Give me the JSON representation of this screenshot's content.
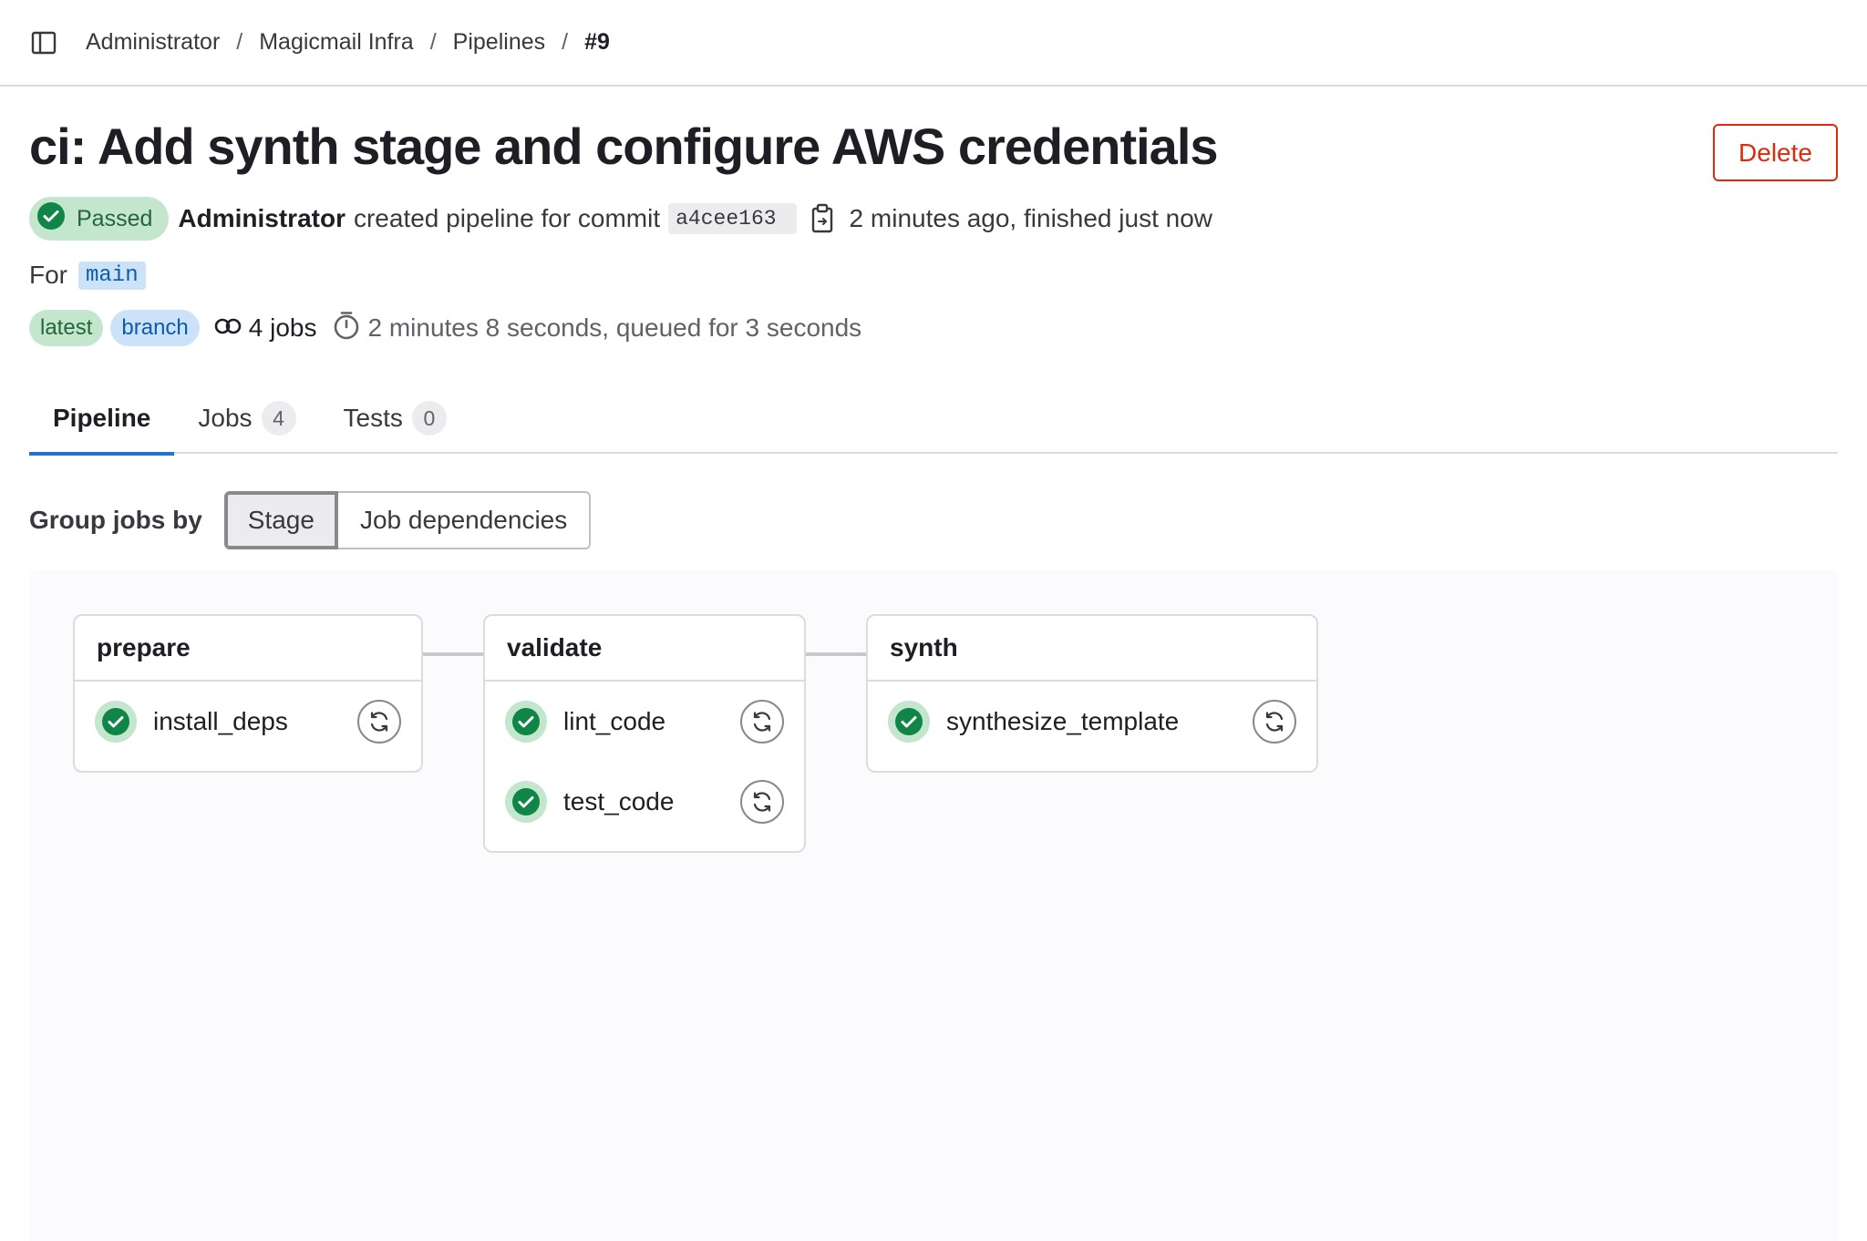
{
  "breadcrumb": {
    "items": [
      "Administrator",
      "Magicmail Infra",
      "Pipelines"
    ],
    "current": "#9",
    "separator": "/"
  },
  "header": {
    "title": "ci: Add synth stage and configure AWS credentials",
    "delete_label": "Delete"
  },
  "meta": {
    "status": "Passed",
    "author": "Administrator",
    "action_text": "created pipeline for commit",
    "sha": "a4cee163",
    "time_text": "2 minutes ago, finished just now",
    "for_label": "For",
    "ref": "main"
  },
  "tags": {
    "latest": "latest",
    "branch": "branch",
    "jobs": "4 jobs",
    "duration": "2 minutes 8 seconds, queued for 3 seconds"
  },
  "tabs": [
    {
      "label": "Pipeline",
      "count": null,
      "active": true
    },
    {
      "label": "Jobs",
      "count": "4",
      "active": false
    },
    {
      "label": "Tests",
      "count": "0",
      "active": false
    }
  ],
  "group_by": {
    "label": "Group jobs by",
    "options": [
      "Stage",
      "Job dependencies"
    ],
    "selected": "Stage"
  },
  "stages": [
    {
      "name": "prepare",
      "jobs": [
        {
          "name": "install_deps",
          "status": "success"
        }
      ]
    },
    {
      "name": "validate",
      "jobs": [
        {
          "name": "lint_code",
          "status": "success"
        },
        {
          "name": "test_code",
          "status": "success"
        }
      ]
    },
    {
      "name": "synth",
      "jobs": [
        {
          "name": "synthesize_template",
          "status": "success"
        }
      ]
    }
  ],
  "colors": {
    "success": "#108548",
    "danger": "#dd2b0e",
    "accent": "#1f75cb"
  },
  "icons": {
    "sidebar": "sidebar-toggle-icon",
    "copy": "clipboard-icon",
    "jobs": "pipeline-jobs-icon",
    "timer": "timer-icon",
    "status": "check-circle-icon",
    "retry": "retry-icon"
  }
}
